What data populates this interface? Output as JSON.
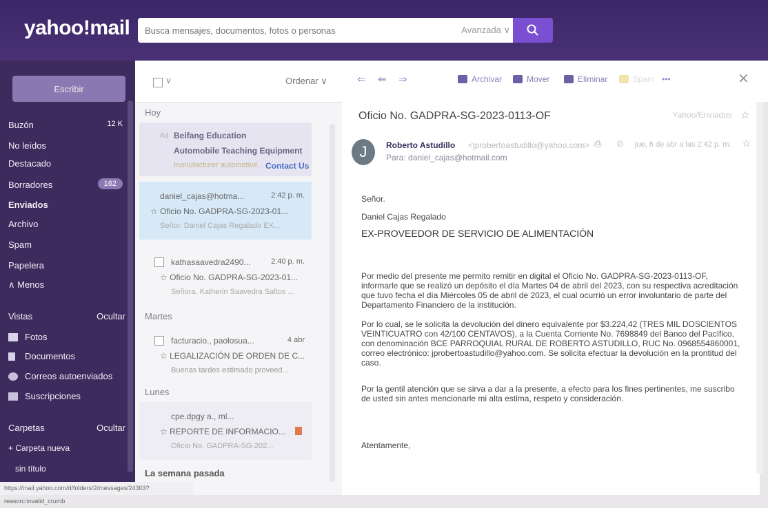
{
  "app": {
    "logo": "yahoo!mail"
  },
  "search": {
    "placeholder": "Busca mensajes, documentos, fotos o personas",
    "advanced": "Avanzada ∨"
  },
  "sidebar": {
    "compose": "Escribir",
    "items": [
      {
        "label": "Buzón",
        "badge": "12 K"
      },
      {
        "label": "No leídos"
      },
      {
        "label": "Destacado"
      },
      {
        "label": "Borradores",
        "badge": "162"
      },
      {
        "label": "Enviados"
      },
      {
        "label": "Archivo"
      },
      {
        "label": "Spam"
      },
      {
        "label": "Papelera"
      },
      {
        "label": "∧ Menos"
      }
    ],
    "views_title": "Vistas",
    "views_hide": "Ocultar",
    "views": [
      {
        "label": "Fotos"
      },
      {
        "label": "Documentos"
      },
      {
        "label": "Correos autoenviados"
      },
      {
        "label": "Suscripciones"
      }
    ],
    "folders_title": "Carpetas",
    "folders_hide": "Ocultar",
    "new_folder": "+ Carpeta nueva",
    "untitled": "sin título"
  },
  "list": {
    "sort": "Ordenar ∨",
    "sections": {
      "hoy": "Hoy",
      "martes": "Martes",
      "lunes": "Lunes",
      "semana": "La semana pasada"
    },
    "ad": {
      "tag": "Ad",
      "title": "Beifang Education",
      "line2": "Automobile Teaching Equipment",
      "line3": "manufacturer automotive...",
      "cta": "Contact Us"
    },
    "messages": [
      {
        "from": "daniel_cajas@hotma...",
        "time": "2:42 p. m.",
        "subject": "Oficio No. GADPRA-SG-2023-01...",
        "preview": "Señor. Daniel Cajas Regalado EX..."
      },
      {
        "from": "kathasaavedra2490...",
        "time": "2:40 p. m.",
        "subject": "Oficio No. GADPRA-SG-2023-01...",
        "preview": "Señora. Katherin Saavedra Saltos ..."
      },
      {
        "from": "facturacio., paolosua...",
        "time": "4 abr",
        "subject": "LEGALIZACIÓN DE ORDEN DE C...",
        "preview": "Buenas tardes estimado proveed..."
      },
      {
        "from": "cpe.dpgy a., ml...",
        "time": "",
        "subject": "REPORTE DE INFORMACIO...",
        "preview": "Oficio No. GADPRA-SG-202..."
      }
    ]
  },
  "toolbar": {
    "archive": "Archivar",
    "move": "Mover",
    "delete": "Eliminar",
    "spam": "Spam",
    "more": "•••"
  },
  "email": {
    "subject": "Oficio No. GADPRA-SG-2023-0113-OF",
    "folder": "Yahoo/Enviados",
    "sender_name": "Roberto Astudillo",
    "sender_email": "<jprobertoastudillo@yahoo.com>",
    "to": "Para: daniel_cajas@hotmail.com",
    "date": "jue, 6 de abr a las 2:42 p. m.",
    "body": {
      "greeting": "Señor.",
      "name": "Daniel Cajas Regalado",
      "title": "EX-PROVEEDOR DE SERVICIO DE ALIMENTACIÓN",
      "p1_l1": "Por medio del presente me permito remitir en digital el Oficio No. GADPRA-SG-2023-0113-OF,",
      "p1_l2": "informarle que se realizó un depósito el día Martes 04 de abril del 2023, con su respectiva acreditación",
      "p1_l3": "que tuvo fecha el día Miércoles 05 de abril de 2023, el cual ocurrió un error involuntario de parte del",
      "p1_l4": "Departamento Financiero de la institución.",
      "p2_l1": "Por lo cual, se le solicita la devolución del dinero equivalente por $3.224,42 (TRES MIL DOSCIENTOS",
      "p2_l2": "VEINTICUATRO con 42/100 CENTAVOS), a la Cuenta Corriente No. 7698849 del Banco del Pacífico,",
      "p2_l3": "con denominación BCE PARROQUIAL RURAL DE ROBERTO ASTUDILLO, RUC No. 0968554860001,",
      "p2_l4": "correo electrónico: jprobertoastudillo@yahoo.com. Se solicita efectuar la devolución en la prontitud del",
      "p2_l5": "caso.",
      "p3_l1": "Por la gentil atención que se sirva a dar a la presente, a efecto para los fines pertinentes, me suscribo",
      "p3_l2": "de usted sin antes mencionarle mi alta estima, respeto y consideración.",
      "closing": "Atentamente,"
    }
  },
  "statusbar": {
    "url": "https://mail.yahoo.com/d/folders/2/messages/24303?reason=invalid_crumb"
  }
}
